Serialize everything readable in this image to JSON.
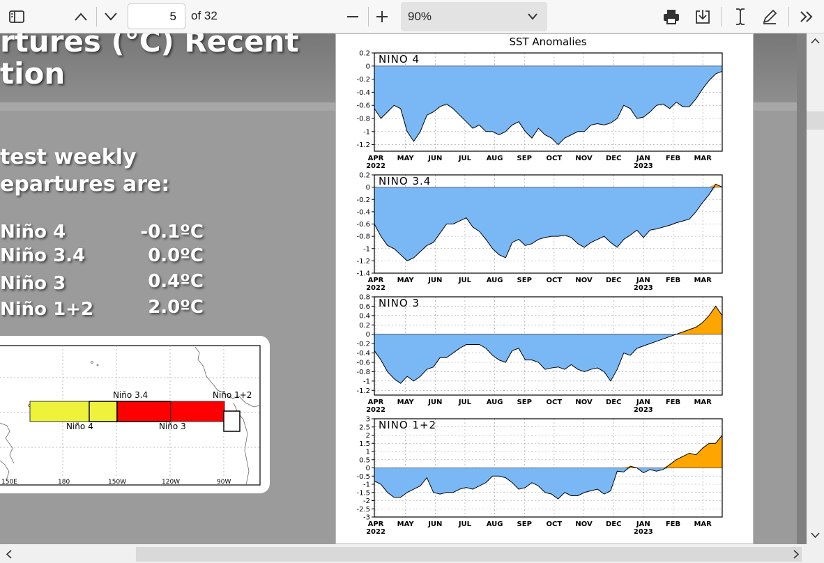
{
  "toolbar": {
    "page_number": "5",
    "page_total": "of 32",
    "zoom_value": "90%",
    "icons": [
      "sidebar-icon",
      "previous-page-icon",
      "next-page-icon",
      "zoom-out-icon",
      "zoom-in-icon",
      "chevron-down-icon",
      "print-icon",
      "save-icon",
      "text-cursor-icon",
      "draw-icon",
      "more-tools-icon"
    ]
  },
  "slide": {
    "title_line1": "rtures (°C) Recent",
    "title_line2": "tion",
    "intro_line1": "test weekly",
    "intro_line2": "epartures are:",
    "readings": [
      {
        "name": "Niño 4",
        "value": "-0.1ºC"
      },
      {
        "name": "Niño 3.4",
        "value": "0.0ºC"
      },
      {
        "name": "Niño 3",
        "value": "0.4ºC"
      },
      {
        "name": "Niño 1+2",
        "value": "2.0ºC"
      }
    ],
    "map": {
      "region_labels": [
        "Niño 3.4",
        "Niño 1+2",
        "Niño 4",
        "Niño 3"
      ],
      "lon_ticks": [
        "150E",
        "180",
        "150W",
        "120W",
        "90W"
      ],
      "colors": {
        "nino4_box": "#eef23a",
        "nino3_box": "#ff0000",
        "nino12_box": "#ffffff"
      }
    }
  },
  "chart_data": [
    {
      "type": "area",
      "title": "SST Anomalies",
      "panel_label": "NINO 4",
      "x_months": [
        "APR",
        "MAY",
        "JUN",
        "JUL",
        "AUG",
        "SEP",
        "OCT",
        "NOV",
        "DEC",
        "JAN",
        "FEB",
        "MAR"
      ],
      "x_years": {
        "APR": "2022",
        "JAN": "2023"
      },
      "ylim": [
        -1.3,
        0.2
      ],
      "yticks": [
        "0.2",
        "0",
        "-0.2",
        "-0.4",
        "-0.6",
        "-0.8",
        "-1",
        "-1.2"
      ],
      "colors": {
        "negative": "#7ab8f5",
        "positive": "#ffa500"
      },
      "values": [
        -0.65,
        -0.8,
        -0.7,
        -0.6,
        -0.65,
        -1.0,
        -1.15,
        -1.0,
        -0.75,
        -0.7,
        -0.62,
        -0.58,
        -0.65,
        -0.75,
        -0.85,
        -0.95,
        -0.9,
        -1.0,
        -1.0,
        -1.05,
        -1.0,
        -0.9,
        -0.85,
        -1.0,
        -1.1,
        -0.95,
        -1.05,
        -1.1,
        -1.2,
        -1.1,
        -1.05,
        -1.0,
        -1.0,
        -0.9,
        -0.88,
        -0.9,
        -0.87,
        -0.8,
        -0.6,
        -0.65,
        -0.8,
        -0.78,
        -0.7,
        -0.6,
        -0.58,
        -0.65,
        -0.55,
        -0.62,
        -0.62,
        -0.5,
        -0.35,
        -0.22,
        -0.12,
        -0.08
      ]
    },
    {
      "type": "area",
      "panel_label": "NINO 3.4",
      "x_months": [
        "APR",
        "MAY",
        "JUN",
        "JUL",
        "AUG",
        "SEP",
        "OCT",
        "NOV",
        "DEC",
        "JAN",
        "FEB",
        "MAR"
      ],
      "x_years": {
        "APR": "2022",
        "JAN": "2023"
      },
      "ylim": [
        -1.4,
        0.2
      ],
      "yticks": [
        "0.2",
        "0",
        "-0.2",
        "-0.4",
        "-0.6",
        "-0.8",
        "-1",
        "-1.2",
        "-1.4"
      ],
      "values": [
        -0.6,
        -0.8,
        -0.95,
        -1.0,
        -1.1,
        -1.2,
        -1.15,
        -1.05,
        -0.95,
        -0.9,
        -0.75,
        -0.6,
        -0.6,
        -0.55,
        -0.5,
        -0.65,
        -0.72,
        -0.85,
        -1.0,
        -1.1,
        -1.15,
        -0.9,
        -0.85,
        -0.95,
        -0.92,
        -0.85,
        -0.82,
        -0.8,
        -0.8,
        -0.78,
        -0.82,
        -0.92,
        -0.98,
        -0.9,
        -0.85,
        -0.8,
        -0.9,
        -0.98,
        -0.85,
        -0.78,
        -0.7,
        -0.82,
        -0.7,
        -0.68,
        -0.65,
        -0.62,
        -0.58,
        -0.55,
        -0.52,
        -0.4,
        -0.25,
        -0.12,
        0.05,
        0.0
      ]
    },
    {
      "type": "area",
      "panel_label": "NINO 3",
      "x_months": [
        "APR",
        "MAY",
        "JUN",
        "JUL",
        "AUG",
        "SEP",
        "OCT",
        "NOV",
        "DEC",
        "JAN",
        "FEB",
        "MAR"
      ],
      "x_years": {
        "APR": "2022",
        "JAN": "2023"
      },
      "ylim": [
        -1.3,
        0.8
      ],
      "yticks": [
        "0.8",
        "0.6",
        "0.4",
        "0.2",
        "0",
        "-0.2",
        "-0.4",
        "-0.6",
        "-0.8",
        "-1",
        "-1.2"
      ],
      "values": [
        -0.35,
        -0.55,
        -0.8,
        -0.95,
        -1.05,
        -0.9,
        -1.0,
        -0.9,
        -0.75,
        -0.7,
        -0.5,
        -0.5,
        -0.4,
        -0.3,
        -0.22,
        -0.22,
        -0.22,
        -0.3,
        -0.45,
        -0.55,
        -0.6,
        -0.35,
        -0.3,
        -0.55,
        -0.55,
        -0.6,
        -0.75,
        -0.72,
        -0.7,
        -0.75,
        -0.65,
        -0.75,
        -0.8,
        -0.75,
        -0.72,
        -0.8,
        -1.0,
        -0.75,
        -0.4,
        -0.45,
        -0.3,
        -0.25,
        -0.2,
        -0.15,
        -0.1,
        -0.05,
        0.0,
        0.05,
        0.1,
        0.15,
        0.25,
        0.4,
        0.6,
        0.4
      ]
    },
    {
      "type": "area",
      "panel_label": "NINO 1+2",
      "x_months": [
        "APR",
        "MAY",
        "JUN",
        "JUL",
        "AUG",
        "SEP",
        "OCT",
        "NOV",
        "DEC",
        "JAN",
        "FEB",
        "MAR"
      ],
      "x_years": {
        "APR": "2022",
        "JAN": "2023"
      },
      "ylim": [
        -3,
        3
      ],
      "yticks": [
        "3",
        "2.5",
        "2",
        "1.5",
        "1",
        "0.5",
        "0",
        "-0.5",
        "-1",
        "-1.5",
        "-2",
        "-2.5",
        "-3"
      ],
      "values": [
        -0.8,
        -1.0,
        -1.5,
        -1.8,
        -1.8,
        -1.5,
        -1.3,
        -1.1,
        -0.6,
        -1.5,
        -1.6,
        -1.5,
        -1.5,
        -1.3,
        -1.2,
        -1.3,
        -1.1,
        -0.9,
        -0.5,
        -0.5,
        -0.6,
        -0.9,
        -1.3,
        -1.2,
        -0.9,
        -1.1,
        -1.5,
        -1.6,
        -1.9,
        -1.5,
        -1.7,
        -1.7,
        -1.5,
        -1.4,
        -1.3,
        -1.6,
        -1.4,
        -0.2,
        -0.25,
        0.1,
        0.0,
        -0.3,
        -0.1,
        -0.2,
        -0.1,
        0.2,
        0.5,
        0.7,
        0.9,
        0.8,
        1.2,
        1.5,
        1.5,
        2.0
      ]
    }
  ]
}
